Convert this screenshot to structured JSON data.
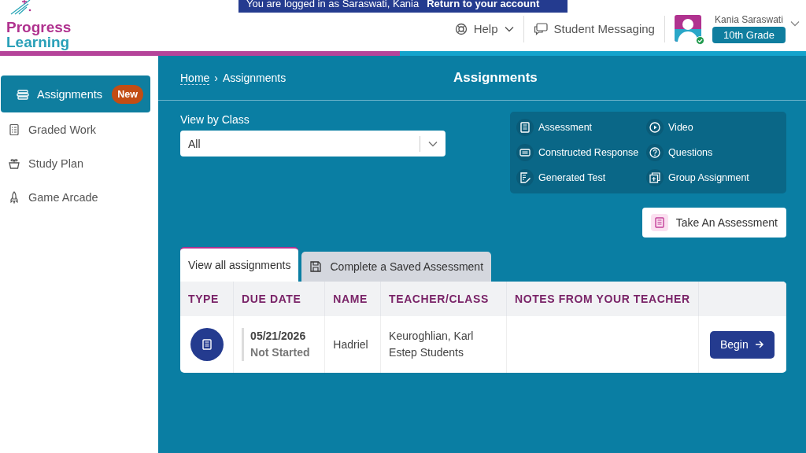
{
  "banner": {
    "text": "You are logged in as Saraswati, Kania",
    "link": "Return to your account"
  },
  "logo": {
    "line_1": "Progress",
    "line_2": "Learning"
  },
  "header": {
    "help": "Help",
    "messaging": "Student Messaging",
    "user_name": "Kania Saraswati",
    "grade": "10th Grade",
    "online": true
  },
  "sidebar": {
    "items": [
      {
        "kind": "assignments",
        "label": "Assignments",
        "badge": "New",
        "selected": true
      },
      {
        "kind": "graded",
        "label": "Graded Work",
        "selected": false
      },
      {
        "kind": "plan",
        "label": "Study Plan",
        "selected": false
      },
      {
        "kind": "arcade",
        "label": "Game Arcade",
        "selected": false
      }
    ]
  },
  "breadcrumb": {
    "home": "Home",
    "separator": "›",
    "current": "Assignments"
  },
  "page_title": "Assignments",
  "filter": {
    "label": "View by Class",
    "value": "All"
  },
  "legend": [
    {
      "kind": "assessment",
      "label": "Assessment"
    },
    {
      "kind": "video",
      "label": "Video"
    },
    {
      "kind": "constructed",
      "label": "Constructed Response"
    },
    {
      "kind": "questions",
      "label": "Questions"
    },
    {
      "kind": "generated",
      "label": "Generated Test"
    },
    {
      "kind": "group",
      "label": "Group Assignment"
    }
  ],
  "take_button": "Take An Assessment",
  "tabs": [
    {
      "label": "View all assignments",
      "selected": true
    },
    {
      "label": "Complete a Saved Assessment",
      "selected": false
    }
  ],
  "table": {
    "columns": [
      "TYPE",
      "DUE DATE",
      "NAME",
      "TEACHER/CLASS",
      "NOTES FROM YOUR TEACHER"
    ],
    "rows": [
      {
        "kind": "assessment",
        "due_date": "05/21/2026",
        "status": "Not Started",
        "name": "Hadriel",
        "teacher": "Keuroghlian, Karl",
        "class": "Estep Students",
        "action": "Begin"
      }
    ]
  }
}
